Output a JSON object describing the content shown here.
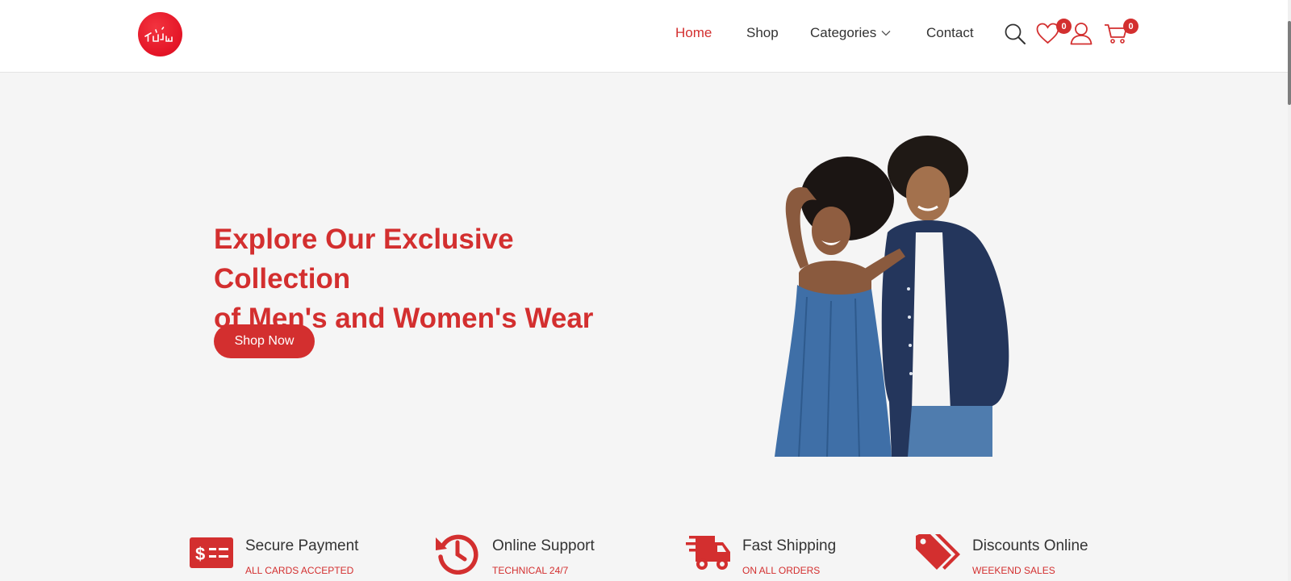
{
  "header": {
    "logo_text": "ٹاٹ",
    "nav": {
      "home": "Home",
      "shop": "Shop",
      "categories": "Categories",
      "contact": "Contact"
    },
    "wishlist_count": "0",
    "cart_count": "0",
    "icons": [
      "search-icon",
      "heart-icon",
      "user-icon",
      "cart-icon",
      "chevron-down-icon"
    ]
  },
  "hero": {
    "title_line1": "Explore Our Exclusive Collection",
    "title_line2": "of Men's and Women's Wear",
    "cta": "Shop Now"
  },
  "features": [
    {
      "title": "Secure Payment",
      "subtitle": "ALL CARDS ACCEPTED",
      "icon": "payment-card-icon"
    },
    {
      "title": "Online Support",
      "subtitle": "TECHNICAL 24/7",
      "icon": "history-clock-icon"
    },
    {
      "title": "Fast Shipping",
      "subtitle": "ON ALL ORDERS",
      "icon": "shipping-truck-icon"
    },
    {
      "title": "Discounts Online",
      "subtitle": "WEEKEND SALES",
      "icon": "price-tags-icon"
    }
  ],
  "colors": {
    "accent": "#d32f2f",
    "logo_red": "#e41426",
    "background": "#f5f5f5",
    "header_bg": "#ffffff",
    "text": "#333333"
  }
}
